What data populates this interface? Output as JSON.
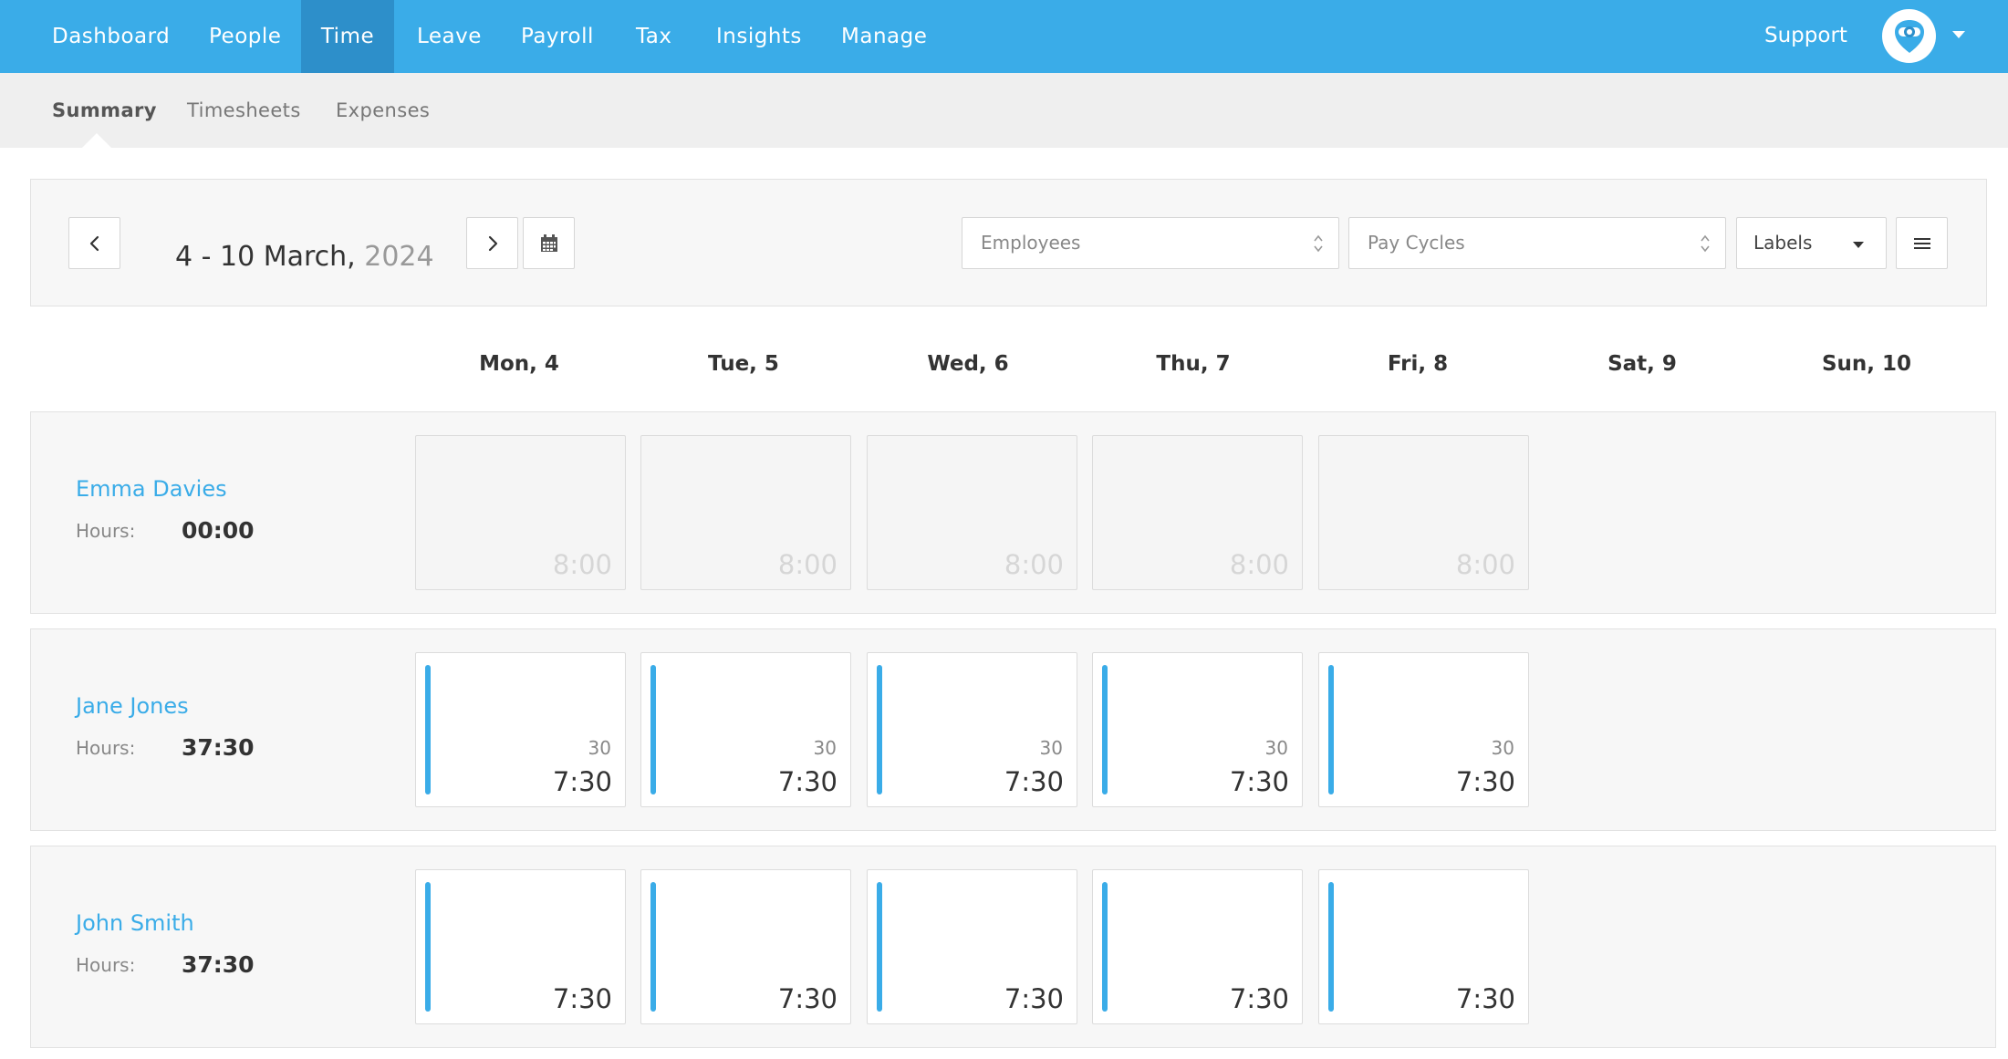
{
  "nav": {
    "items": [
      "Dashboard",
      "People",
      "Time",
      "Leave",
      "Payroll",
      "Tax",
      "Insights",
      "Manage"
    ],
    "active": "Time",
    "support": "Support"
  },
  "subnav": {
    "items": [
      "Summary",
      "Timesheets",
      "Expenses"
    ],
    "active": "Summary"
  },
  "toolbar": {
    "date_range": "4 - 10 March,",
    "year": "2024",
    "employees_placeholder": "Employees",
    "pay_cycles_placeholder": "Pay Cycles",
    "labels_button": "Labels"
  },
  "days": [
    "Mon, 4",
    "Tue, 5",
    "Wed, 6",
    "Thu, 7",
    "Fri, 8",
    "Sat, 9",
    "Sun, 10"
  ],
  "hours_label": "Hours:",
  "employees": [
    {
      "name": "Emma Davies",
      "hours": "00:00",
      "cells": [
        {
          "state": "empty",
          "value": "8:00",
          "sub": ""
        },
        {
          "state": "empty",
          "value": "8:00",
          "sub": ""
        },
        {
          "state": "empty",
          "value": "8:00",
          "sub": ""
        },
        {
          "state": "empty",
          "value": "8:00",
          "sub": ""
        },
        {
          "state": "empty",
          "value": "8:00",
          "sub": ""
        }
      ]
    },
    {
      "name": "Jane Jones",
      "hours": "37:30",
      "cells": [
        {
          "state": "filled",
          "value": "7:30",
          "sub": "30"
        },
        {
          "state": "filled",
          "value": "7:30",
          "sub": "30"
        },
        {
          "state": "filled",
          "value": "7:30",
          "sub": "30"
        },
        {
          "state": "filled",
          "value": "7:30",
          "sub": "30"
        },
        {
          "state": "filled",
          "value": "7:30",
          "sub": "30"
        }
      ]
    },
    {
      "name": "John Smith",
      "hours": "37:30",
      "cells": [
        {
          "state": "filled",
          "value": "7:30",
          "sub": ""
        },
        {
          "state": "filled",
          "value": "7:30",
          "sub": ""
        },
        {
          "state": "filled",
          "value": "7:30",
          "sub": ""
        },
        {
          "state": "filled",
          "value": "7:30",
          "sub": ""
        },
        {
          "state": "filled",
          "value": "7:30",
          "sub": ""
        }
      ]
    }
  ],
  "colors": {
    "accent": "#3aace8",
    "nav_active": "#2d8fca",
    "subnav_bg": "#efefef",
    "panel_bg": "#f7f7f7"
  },
  "icons": {
    "prev": "chevron-left-icon",
    "next": "chevron-right-icon",
    "calendar": "calendar-icon",
    "menu": "hamburger-icon",
    "avatar": "user-avatar-icon"
  }
}
